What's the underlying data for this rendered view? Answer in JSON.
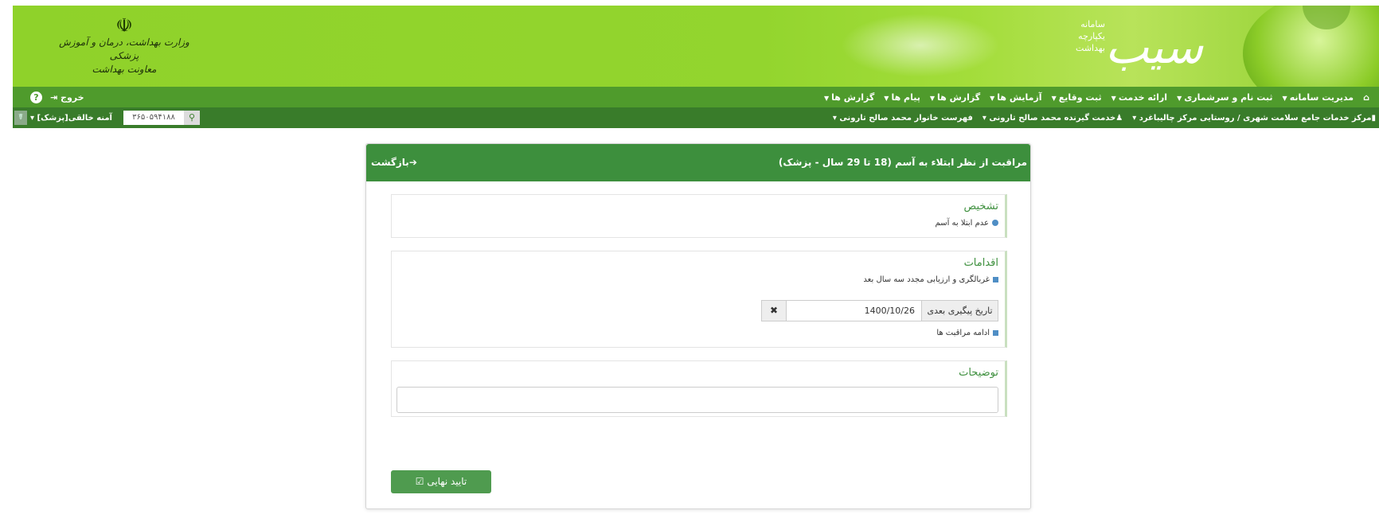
{
  "header": {
    "ministry_lines": [
      "وزارت بهداشت، درمان و آموزش پزشکی",
      "معاونت بهداشت"
    ],
    "emblem_icon": "iran-emblem-icon",
    "logo_small_lines": [
      "سامانه",
      "یکپارچه",
      "بهداشت"
    ],
    "logo_main": "سیب"
  },
  "nav": {
    "home_icon": "home-icon",
    "items": [
      "مدیریت سامانه",
      "ثبت نام و سرشماری",
      "ارائه خدمت",
      "ثبت وقایع",
      "آزمایش ها",
      "گزارش ها",
      "پیام ها",
      "گزارش ها"
    ],
    "logout": "خروج",
    "help_icon": "help-icon"
  },
  "subnav": {
    "center": "مرکز خدمات جامع سلامت شهری / روستایی مرکز چالیباغرد",
    "recipient": "خدمت گیرنده محمد صالح تارونی",
    "family": "فهرست خانوار محمد صالح تارونی",
    "user": "آمنه خالقی[پزشک]",
    "national_id": "۳۶۵۰۵۹۴۱۸۸",
    "toggle_icon": "stethoscope-icon",
    "search_icon": "search-icon"
  },
  "panel": {
    "title": "مراقبت از نظر ابتلاء به آسم (18 تا 29 سال - پزشک)",
    "back": "بازگشت",
    "diagnosis": {
      "title": "تشخیص",
      "item": "عدم ابتلا به آسم"
    },
    "actions": {
      "title": "اقدامات",
      "item1": "غربالگری و ارزیابی مجدد سه سال بعد",
      "date_label": "تاریخ پیگیری بعدی",
      "date_value": "1400/10/26",
      "clear_icon": "✖",
      "item2": "ادامه مراقبت ها"
    },
    "notes": {
      "title": "توضیحات",
      "value": ""
    },
    "submit": "تایید نهایی",
    "submit_icon": "☑"
  },
  "colors": {
    "banner": "#93d52e",
    "nav": "#4f9b2c",
    "subnav": "#397c2a",
    "panel_head": "#3d8f3d",
    "accent_blue": "#4f8ec5"
  }
}
